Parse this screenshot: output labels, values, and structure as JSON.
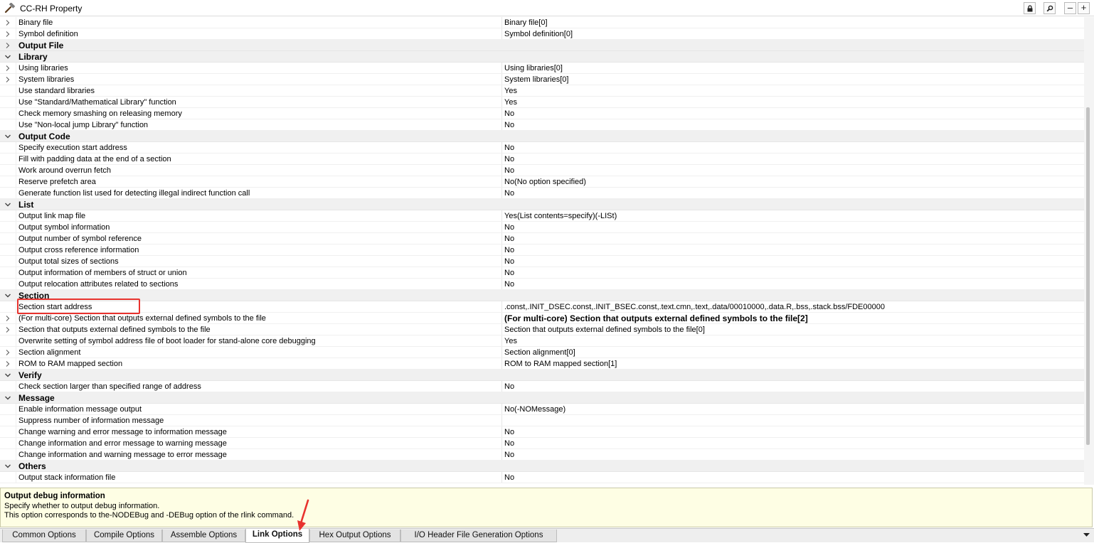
{
  "window": {
    "title": "CC-RH Property"
  },
  "titlebar_buttons": [
    {
      "name": "lock-button",
      "icon": "lock-icon"
    },
    {
      "name": "search-button",
      "icon": "magnifier-icon"
    },
    {
      "name": "minimize-button",
      "icon": "minus-icon",
      "label": "–"
    },
    {
      "name": "add-button",
      "icon": "plus-icon",
      "label": "+"
    }
  ],
  "rows": [
    {
      "type": "item",
      "expander": "collapsed",
      "name": "Binary file",
      "value": "Binary file[0]"
    },
    {
      "type": "item",
      "expander": "collapsed",
      "name": "Symbol definition",
      "value": "Symbol definition[0]"
    },
    {
      "type": "category",
      "expander": "collapsed",
      "name": "Output File"
    },
    {
      "type": "category",
      "expander": "expanded",
      "name": "Library"
    },
    {
      "type": "item",
      "expander": "collapsed",
      "name": "Using libraries",
      "value": "Using libraries[0]"
    },
    {
      "type": "item",
      "expander": "collapsed",
      "name": "System libraries",
      "value": "System libraries[0]"
    },
    {
      "type": "item",
      "name": "Use standard libraries",
      "value": "Yes"
    },
    {
      "type": "item",
      "name": "Use \"Standard/Mathematical Library\" function",
      "value": "Yes"
    },
    {
      "type": "item",
      "name": "Check memory smashing on releasing memory",
      "value": "No"
    },
    {
      "type": "item",
      "name": "Use \"Non-local jump Library\" function",
      "value": "No"
    },
    {
      "type": "category",
      "expander": "expanded",
      "name": "Output Code"
    },
    {
      "type": "item",
      "name": "Specify execution start address",
      "value": "No"
    },
    {
      "type": "item",
      "name": "Fill with padding data at the end of a section",
      "value": "No"
    },
    {
      "type": "item",
      "name": "Work around overrun fetch",
      "value": "No"
    },
    {
      "type": "item",
      "name": "Reserve prefetch area",
      "value": "No(No option specified)"
    },
    {
      "type": "item",
      "name": "Generate function list used for detecting illegal indirect function call",
      "value": "No"
    },
    {
      "type": "category",
      "expander": "expanded",
      "name": "List"
    },
    {
      "type": "item",
      "name": "Output link map file",
      "value": "Yes(List contents=specify)(-LISt)"
    },
    {
      "type": "item",
      "name": "Output symbol information",
      "value": "No"
    },
    {
      "type": "item",
      "name": "Output number of symbol reference",
      "value": "No"
    },
    {
      "type": "item",
      "name": "Output cross reference information",
      "value": "No"
    },
    {
      "type": "item",
      "name": "Output total sizes of sections",
      "value": "No"
    },
    {
      "type": "item",
      "name": "Output information of members of struct or union",
      "value": "No"
    },
    {
      "type": "item",
      "name": "Output relocation attributes related to sections",
      "value": "No"
    },
    {
      "type": "category",
      "expander": "expanded",
      "name": "Section"
    },
    {
      "type": "item",
      "name": "Section start address",
      "value": ".const,.INIT_DSEC.const,.INIT_BSEC.const,.text.cmn,.text,.data/00010000,.data.R,.bss,.stack.bss/FDE00000",
      "highlighted": true
    },
    {
      "type": "item",
      "expander": "collapsed",
      "name": "(For multi-core) Section that outputs external defined symbols to the file",
      "value": "(For multi-core) Section that outputs external defined symbols to the file[2]",
      "bold_value": true
    },
    {
      "type": "item",
      "expander": "collapsed",
      "name": "Section that outputs external defined symbols to the file",
      "value": "Section that outputs external defined symbols to the file[0]"
    },
    {
      "type": "item",
      "name": "Overwrite setting of symbol address file of boot loader for stand-alone core debugging",
      "value": "Yes"
    },
    {
      "type": "item",
      "expander": "collapsed",
      "name": "Section alignment",
      "value": "Section alignment[0]"
    },
    {
      "type": "item",
      "expander": "collapsed",
      "name": "ROM to RAM mapped section",
      "value": "ROM to RAM mapped section[1]"
    },
    {
      "type": "category",
      "expander": "expanded",
      "name": "Verify"
    },
    {
      "type": "item",
      "name": "Check section larger than specified range of address",
      "value": "No"
    },
    {
      "type": "category",
      "expander": "expanded",
      "name": "Message"
    },
    {
      "type": "item",
      "name": "Enable information message output",
      "value": "No(-NOMessage)"
    },
    {
      "type": "item",
      "name": "Suppress number of information message",
      "value": ""
    },
    {
      "type": "item",
      "name": "Change warning and error message to information message",
      "value": "No"
    },
    {
      "type": "item",
      "name": "Change information and error message to warning message",
      "value": "No"
    },
    {
      "type": "item",
      "name": "Change information and warning message to error message",
      "value": "No"
    },
    {
      "type": "category",
      "expander": "expanded",
      "name": "Others"
    },
    {
      "type": "item",
      "name": "Output stack information file",
      "value": "No"
    }
  ],
  "description": {
    "title": "Output debug information",
    "line1": "Specify whether to output debug information.",
    "line2": "This option corresponds to the-NODEBug and -DEBug option of the rlink command."
  },
  "tabs": [
    {
      "label": "Common Options",
      "active": false
    },
    {
      "label": "Compile Options",
      "active": false
    },
    {
      "label": "Assemble Options",
      "active": false
    },
    {
      "label": "Link Options",
      "active": true
    },
    {
      "label": "Hex Output Options",
      "active": false
    },
    {
      "label": "I/O Header File Generation Options",
      "active": false
    }
  ],
  "colors": {
    "highlight_box": "#e8332e",
    "annotation_arrow": "#e8332e",
    "category_bg": "#f0f0f0",
    "description_bg": "#fefee4"
  }
}
